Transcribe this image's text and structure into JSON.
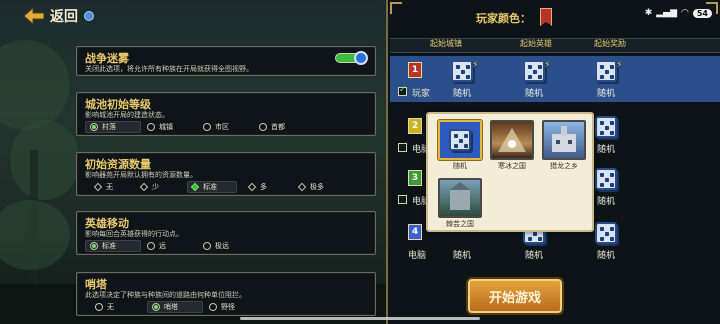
{
  "header": {
    "title": "返回",
    "back_icon": "back-arrow-icon"
  },
  "options": [
    {
      "title": "战争迷雾",
      "desc": "关闭此选项，将允许所有种族在开局就获得全图视野。",
      "type": "toggle",
      "enabled": true
    },
    {
      "title": "城池初始等级",
      "desc": "影响城池开局的建造状态。",
      "type": "radio",
      "choices": [
        "村落",
        "城镇",
        "市区",
        "首都"
      ],
      "selected": 0
    },
    {
      "title": "初始资源数量",
      "desc": "影响器苑开局默认拥有的资源数量。",
      "type": "diamond",
      "choices": [
        "无",
        "少",
        "标准",
        "多",
        "极多"
      ],
      "selected": 2
    },
    {
      "title": "英雄移动",
      "desc": "影响每回合英雄获得的行动点。",
      "type": "radio",
      "choices": [
        "标准",
        "远",
        "极远"
      ],
      "selected": 0
    },
    {
      "title": "哨塔",
      "desc": "此选项决定了种族与种族间的道路由何种单位阻拦。",
      "type": "radio",
      "choices": [
        "无",
        "哨塔",
        "野怪"
      ],
      "selected": 1
    }
  ],
  "panel": {
    "player_color_label": "玩家颜色：",
    "player_color": "#b8332a",
    "columns": [
      "起始城镇",
      "起始英雄",
      "起始奖励"
    ],
    "rows": [
      {
        "number": "1",
        "label": "玩家",
        "color": "#b8332a",
        "checked": true,
        "cells": [
          "随机",
          "随机",
          "随机"
        ]
      },
      {
        "number": "2",
        "label": "电脑",
        "color": "#c9b422",
        "checked": false,
        "cells": [
          "随机",
          "随机",
          "随机"
        ]
      },
      {
        "number": "3",
        "label": "电脑",
        "color": "#3c9a3a",
        "checked": false,
        "cells": [
          "随机",
          "随机",
          "随机"
        ]
      },
      {
        "number": "4",
        "label": "电脑",
        "color": "#3a5fd1",
        "checked": false,
        "cells": [
          "随机",
          "随机",
          "随机"
        ]
      }
    ],
    "popup": {
      "items": [
        "随机",
        "寒冰之国",
        "猎龙之乡",
        "棘芸之国"
      ],
      "selected": 0
    },
    "start_button": "开始游戏"
  },
  "status_bar": {
    "battery": "54"
  },
  "colors": {
    "accent": "#e9c96a",
    "toggle_on": "#3dbb3a",
    "start": "#e3a23c",
    "row_highlight": "#2a4f8a"
  }
}
